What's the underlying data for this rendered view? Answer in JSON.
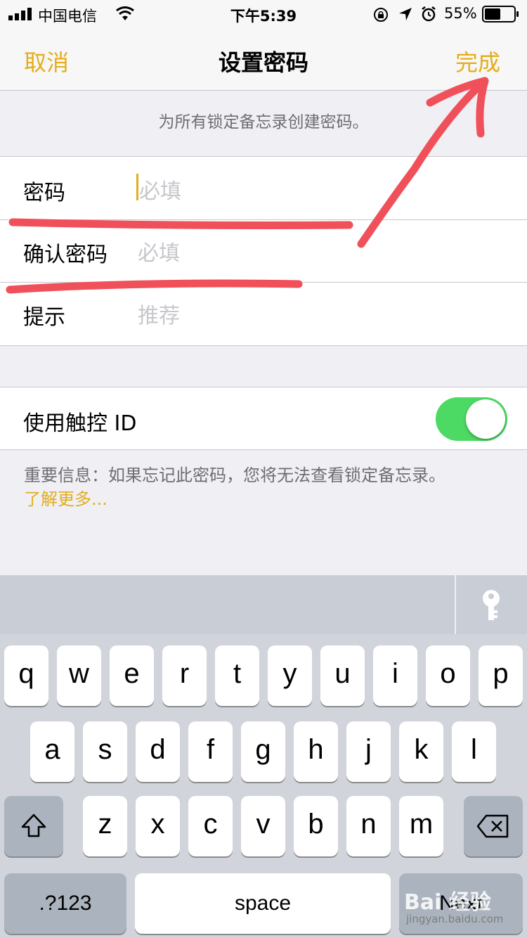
{
  "status_bar": {
    "carrier": "中国电信",
    "time": "下午5:39",
    "battery_percent": "55%",
    "battery_level": 0.55
  },
  "nav": {
    "cancel": "取消",
    "title": "设置密码",
    "done": "完成"
  },
  "hint": "为所有锁定备忘录创建密码。",
  "fields": [
    {
      "label": "密码",
      "placeholder": "必填"
    },
    {
      "label": "确认密码",
      "placeholder": "必填"
    },
    {
      "label": "提示",
      "placeholder": "推荐"
    }
  ],
  "touch_id": {
    "label": "使用触控 ID",
    "enabled": true
  },
  "info_text": "重要信息：如果忘记此密码，您将无法查看锁定备忘录。",
  "learn_more": "了解更多...",
  "keyboard": {
    "row1": [
      "q",
      "w",
      "e",
      "r",
      "t",
      "y",
      "u",
      "i",
      "o",
      "p"
    ],
    "row2": [
      "a",
      "s",
      "d",
      "f",
      "g",
      "h",
      "j",
      "k",
      "l"
    ],
    "row3": [
      "z",
      "x",
      "c",
      "v",
      "b",
      "n",
      "m"
    ],
    "numbers_key": ".?123",
    "space_key": "space",
    "next_key": "Next"
  },
  "watermark": {
    "logo": "Bai 经验",
    "url": "jingyan.baidu.com"
  },
  "colors": {
    "accent": "#e4ad1c",
    "toggle_on": "#4cd964",
    "annotation": "#f0505a"
  }
}
